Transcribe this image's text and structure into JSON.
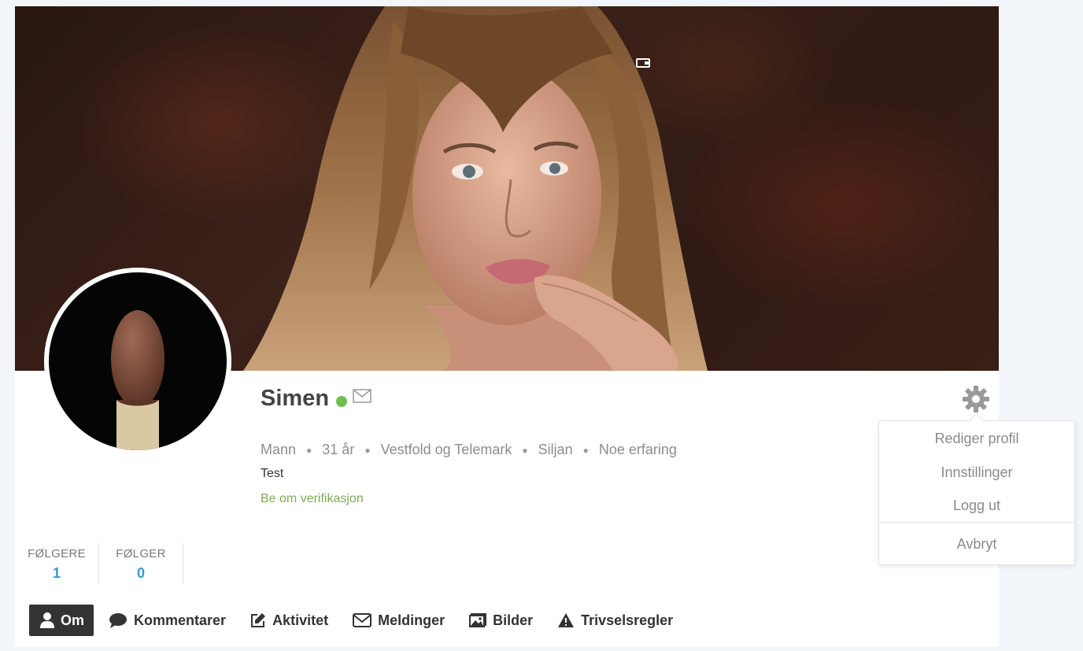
{
  "profile": {
    "name": "Simen",
    "online_color": "#6cc04a",
    "meta": [
      "Mann",
      "31 år",
      "Vestfold og Telemark",
      "Siljan",
      "Noe erfaring"
    ],
    "bio": "Test",
    "verify_link": "Be om verifikasjon"
  },
  "stats": [
    {
      "label": "FØLGERE",
      "count": "1"
    },
    {
      "label": "FØLGER",
      "count": "0"
    }
  ],
  "nav": [
    {
      "label": "Om",
      "icon": "user-icon",
      "active": true
    },
    {
      "label": "Kommentarer",
      "icon": "speech-bubble-icon"
    },
    {
      "label": "Aktivitet",
      "icon": "edit-icon"
    },
    {
      "label": "Meldinger",
      "icon": "envelope-icon"
    },
    {
      "label": "Bilder",
      "icon": "images-icon"
    },
    {
      "label": "Trivselsregler",
      "icon": "warning-icon"
    }
  ],
  "settings_menu": {
    "items": [
      "Rediger profil",
      "Innstillinger",
      "Logg ut"
    ],
    "cancel": "Avbryt"
  },
  "colors": {
    "accent_blue": "#3a96d2",
    "link_green": "#7eaa55",
    "nav_active_bg": "#333333"
  }
}
